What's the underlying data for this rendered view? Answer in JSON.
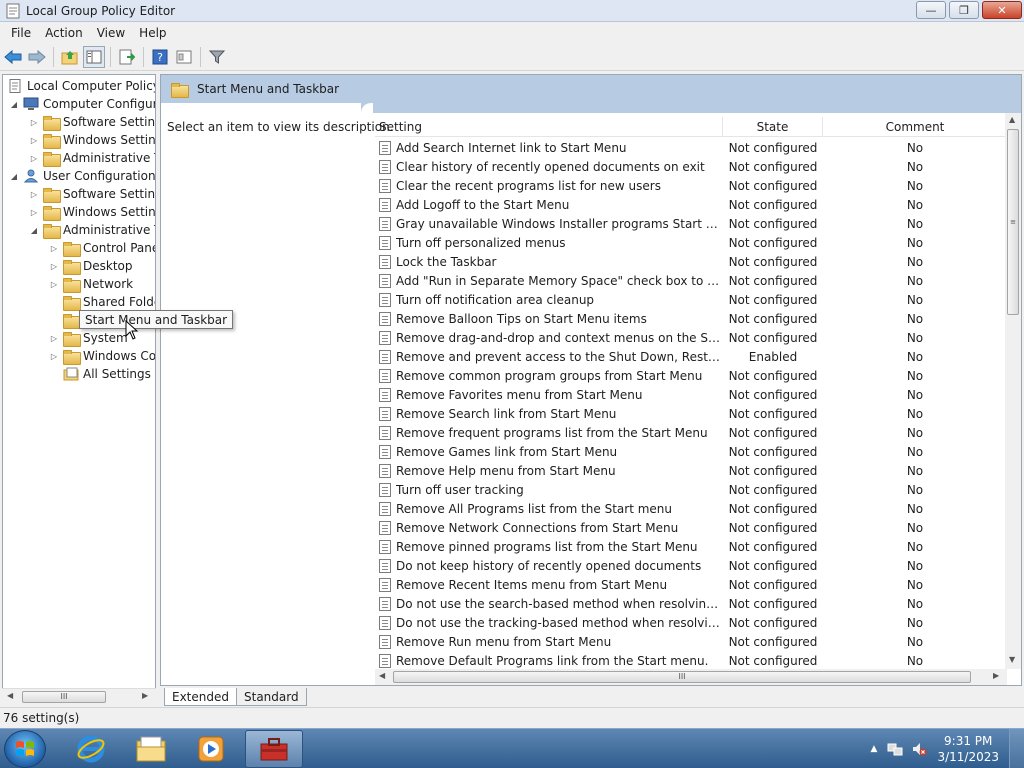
{
  "window": {
    "title": "Local Group Policy Editor",
    "controls": {
      "minimize": "—",
      "maximize": "❐",
      "close": "✕"
    }
  },
  "menu": [
    "File",
    "Action",
    "View",
    "Help"
  ],
  "toolbar_icons": [
    "back-icon",
    "forward-icon",
    "up-folder-icon",
    "show-hide-tree-icon",
    "export-list-icon",
    "help-icon",
    "properties-icon",
    "filter-icon"
  ],
  "tree": {
    "root": "Local Computer Policy",
    "items": [
      {
        "label": "Computer Configura",
        "level": 1,
        "expander": "◢",
        "icon": "computer-icon"
      },
      {
        "label": "Software Settings",
        "level": 2,
        "expander": "▷",
        "icon": "folder-icon"
      },
      {
        "label": "Windows Setting",
        "level": 2,
        "expander": "▷",
        "icon": "folder-icon"
      },
      {
        "label": "Administrative Te",
        "level": 2,
        "expander": "▷",
        "icon": "folder-icon"
      },
      {
        "label": "User Configuration",
        "level": 1,
        "expander": "◢",
        "icon": "user-icon"
      },
      {
        "label": "Software Settings",
        "level": 2,
        "expander": "▷",
        "icon": "folder-icon"
      },
      {
        "label": "Windows Setting",
        "level": 2,
        "expander": "▷",
        "icon": "folder-icon"
      },
      {
        "label": "Administrative Te",
        "level": 2,
        "expander": "◢",
        "icon": "folder-icon"
      },
      {
        "label": "Control Panel",
        "level": 3,
        "expander": "▷",
        "icon": "folder-icon"
      },
      {
        "label": "Desktop",
        "level": 3,
        "expander": "▷",
        "icon": "folder-icon"
      },
      {
        "label": "Network",
        "level": 3,
        "expander": "▷",
        "icon": "folder-icon"
      },
      {
        "label": "Shared Folder",
        "level": 3,
        "expander": "",
        "icon": "folder-icon"
      },
      {
        "label": "",
        "level": 3,
        "expander": "",
        "icon": "folder-icon"
      },
      {
        "label": "System",
        "level": 3,
        "expander": "▷",
        "icon": "folder-icon"
      },
      {
        "label": "Windows Cor",
        "level": 3,
        "expander": "▷",
        "icon": "folder-icon"
      },
      {
        "label": "All Settings",
        "level": 3,
        "expander": "",
        "icon": "all-settings-icon"
      }
    ],
    "tooltip": "Start Menu and Taskbar"
  },
  "details": {
    "header": "Start Menu and Taskbar",
    "description": "Select an item to view its description.",
    "columns": {
      "setting": "Setting",
      "state": "State",
      "comment": "Comment"
    },
    "rows": [
      [
        "Add Search Internet link to Start Menu",
        "Not configured",
        "No"
      ],
      [
        "Clear history of recently opened documents on exit",
        "Not configured",
        "No"
      ],
      [
        "Clear the recent programs list for new users",
        "Not configured",
        "No"
      ],
      [
        "Add Logoff to the Start Menu",
        "Not configured",
        "No"
      ],
      [
        "Gray unavailable Windows Installer programs Start Menu sh...",
        "Not configured",
        "No"
      ],
      [
        "Turn off personalized menus",
        "Not configured",
        "No"
      ],
      [
        "Lock the Taskbar",
        "Not configured",
        "No"
      ],
      [
        "Add \"Run in Separate Memory Space\" check box to Run dial...",
        "Not configured",
        "No"
      ],
      [
        "Turn off notification area cleanup",
        "Not configured",
        "No"
      ],
      [
        "Remove Balloon Tips on Start Menu items",
        "Not configured",
        "No"
      ],
      [
        "Remove drag-and-drop and context menus on the Start Me...",
        "Not configured",
        "No"
      ],
      [
        "Remove and prevent access to the Shut Down, Restart, Sleep...",
        "Enabled",
        "No"
      ],
      [
        "Remove common program groups from Start Menu",
        "Not configured",
        "No"
      ],
      [
        "Remove Favorites menu from Start Menu",
        "Not configured",
        "No"
      ],
      [
        "Remove Search link from Start Menu",
        "Not configured",
        "No"
      ],
      [
        "Remove frequent programs list from the Start Menu",
        "Not configured",
        "No"
      ],
      [
        "Remove Games link from Start Menu",
        "Not configured",
        "No"
      ],
      [
        "Remove Help menu from Start Menu",
        "Not configured",
        "No"
      ],
      [
        "Turn off user tracking",
        "Not configured",
        "No"
      ],
      [
        "Remove All Programs list from the Start menu",
        "Not configured",
        "No"
      ],
      [
        "Remove Network Connections from Start Menu",
        "Not configured",
        "No"
      ],
      [
        "Remove pinned programs list from the Start Menu",
        "Not configured",
        "No"
      ],
      [
        "Do not keep history of recently opened documents",
        "Not configured",
        "No"
      ],
      [
        "Remove Recent Items menu from Start Menu",
        "Not configured",
        "No"
      ],
      [
        "Do not use the search-based method when resolving shell s...",
        "Not configured",
        "No"
      ],
      [
        "Do not use the tracking-based method when resolving shell ...",
        "Not configured",
        "No"
      ],
      [
        "Remove Run menu from Start Menu",
        "Not configured",
        "No"
      ],
      [
        "Remove Default Programs link from the Start menu.",
        "Not configured",
        "No"
      ]
    ]
  },
  "tabs": [
    "Extended",
    "Standard"
  ],
  "status": "76 setting(s)",
  "scroll_glyphs": {
    "left": "◀",
    "right": "▶",
    "up": "▲",
    "down": "▼",
    "grip": "III",
    "grip_v": "≡"
  },
  "taskbar": {
    "apps": [
      "internet-explorer-icon",
      "explorer-icon",
      "media-player-icon",
      "group-policy-icon"
    ],
    "time": "9:31 PM",
    "date": "3/11/2023",
    "tray_arrow": "▲"
  }
}
